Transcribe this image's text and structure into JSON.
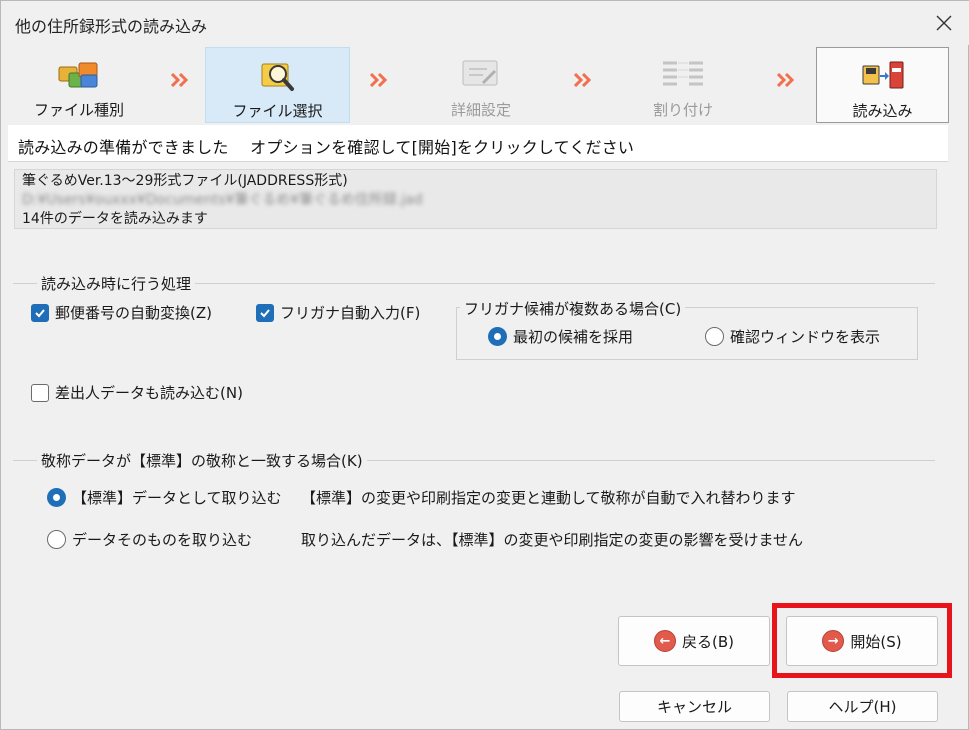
{
  "window": {
    "title": "他の住所録形式の読み込み"
  },
  "steps": [
    {
      "label": "ファイル種別",
      "icon": "folders-icon",
      "state": "normal"
    },
    {
      "label": "ファイル選択",
      "icon": "magnifier-icon",
      "state": "active"
    },
    {
      "label": "詳細設定",
      "icon": "settings-tools-icon",
      "state": "disabled"
    },
    {
      "label": "割り付け",
      "icon": "mapping-lines-icon",
      "state": "disabled"
    },
    {
      "label": "読み込み",
      "icon": "import-book-icon",
      "state": "current"
    }
  ],
  "banner": {
    "text": "読み込みの準備ができました　 オプションを確認して[開始]をクリックしてください"
  },
  "file_info": {
    "line1": "筆ぐるめVer.13～29形式ファイル(JADDRESS形式)",
    "line2": "D:¥Users¥ouxxx¥Documents¥筆ぐるめ¥筆ぐるめ住所録.jad",
    "line3": "14件のデータを読み込みます"
  },
  "processing": {
    "group_label": "読み込み時に行う処理",
    "postal_convert": {
      "label": "郵便番号の自動変換(Z)",
      "checked": true
    },
    "furigana_input": {
      "label": "フリガナ自動入力(F)",
      "checked": true
    },
    "furigana_multi": {
      "group_label": "フリガナ候補が複数ある場合(C)",
      "options": [
        "最初の候補を採用",
        "確認ウィンドウを表示"
      ],
      "selected": "最初の候補を採用"
    },
    "sender_data": {
      "label": "差出人データも読み込む(N)",
      "checked": false
    }
  },
  "honorific": {
    "group_label": "敬称データが【標準】の敬称と一致する場合(K)",
    "option1": {
      "label": "【標準】データとして取り込む",
      "desc": "【標準】の変更や印刷指定の変更と連動して敬称が自動で入れ替わります",
      "selected": true
    },
    "option2": {
      "label": "データそのものを取り込む",
      "desc": "取り込んだデータは、【標準】の変更や印刷指定の変更の影響を受けません",
      "selected": false
    }
  },
  "buttons": {
    "back": "戻る(B)",
    "start": "開始(S)",
    "cancel": "キャンセル",
    "help": "ヘルプ(H)"
  },
  "colors": {
    "accent": "#1f6fb8",
    "highlight": "#e8141c",
    "arrow": "#f07050",
    "button_icon": "#e15a4c"
  }
}
